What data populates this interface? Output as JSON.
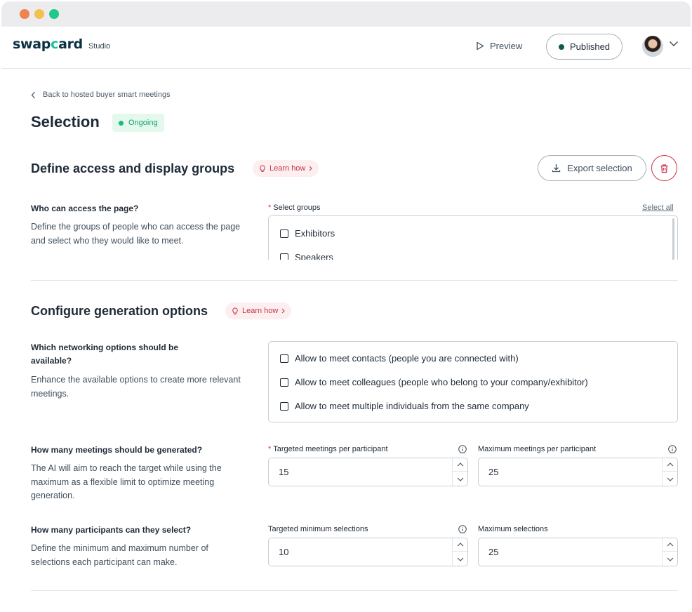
{
  "window": {
    "traffic_lights": [
      "#f0824f",
      "#f4c04e",
      "#1ec98a"
    ]
  },
  "header": {
    "logo_prefix": "swap",
    "logo_accent": "c",
    "logo_suffix": "ard",
    "studio_label": "Studio",
    "preview_label": "Preview",
    "published_label": "Published"
  },
  "page": {
    "back_label": "Back to hosted buyer smart meetings",
    "title": "Selection",
    "status": "Ongoing"
  },
  "access_section": {
    "title": "Define access and display groups",
    "learn_how": "Learn how",
    "export_label": "Export selection",
    "question": "Who can access the page?",
    "description": "Define the groups of people who can access the page and select who they would like to meet.",
    "groups_label": "Select groups",
    "select_all": "Select all",
    "groups": [
      "Exhibitors",
      "Speakers"
    ]
  },
  "generation_section": {
    "title": "Configure generation options",
    "learn_how": "Learn how",
    "networking": {
      "question": "Which networking options should be available?",
      "description": "Enhance the available options to create more relevant meetings.",
      "options": [
        "Allow to meet contacts (people you are connected with)",
        "Allow to meet colleagues (people who belong to your company/exhibitor)",
        "Allow to meet multiple individuals from the same company"
      ]
    },
    "meetings": {
      "question": "How many meetings should be generated?",
      "description": "The AI will aim to reach the target while using the maximum as a flexible limit to optimize meeting generation.",
      "targeted_label": "Targeted meetings per participant",
      "targeted_value": "15",
      "maximum_label": "Maximum meetings per participant",
      "maximum_value": "25"
    },
    "selections": {
      "question": "How many participants can they select?",
      "description": "Define the minimum and maximum number of selections each participant can make.",
      "min_label": "Targeted minimum selections",
      "min_value": "10",
      "max_label": "Maximum selections",
      "max_value": "25"
    }
  }
}
